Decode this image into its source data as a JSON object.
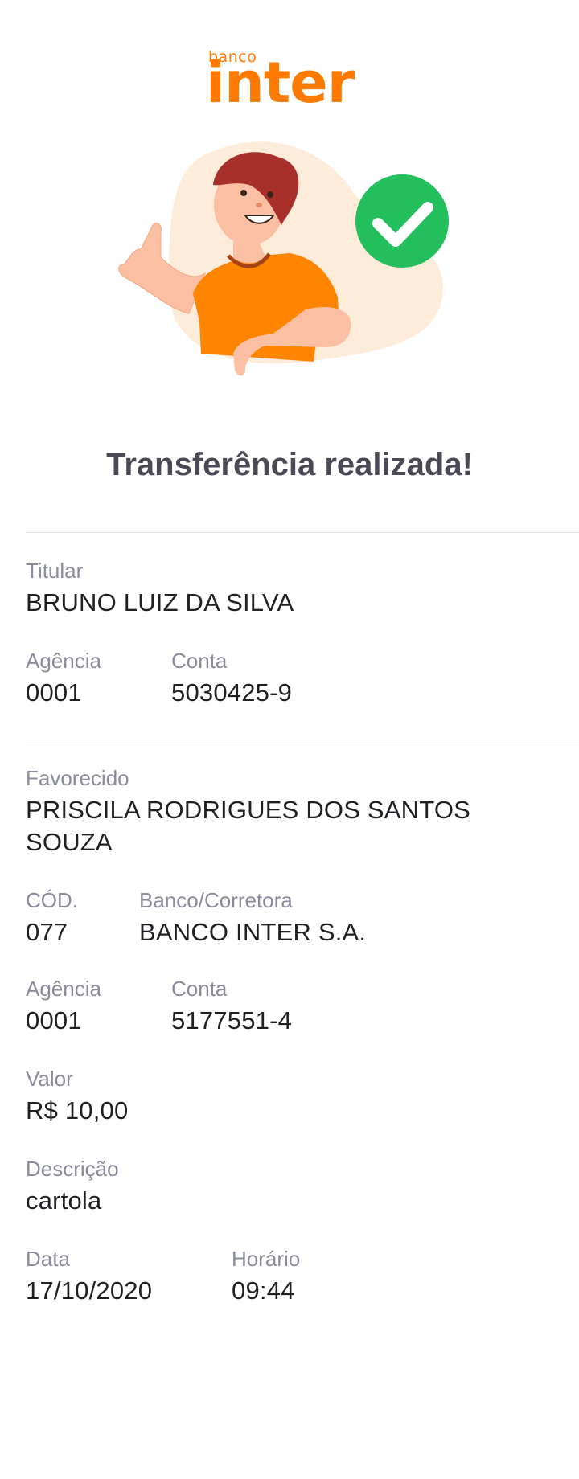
{
  "brand": {
    "small": "banco",
    "name": "inter"
  },
  "title": "Transferência realizada!",
  "holder": {
    "titular_label": "Titular",
    "titular_value": "BRUNO LUIZ DA SILVA",
    "agencia_label": "Agência",
    "agencia_value": "0001",
    "conta_label": "Conta",
    "conta_value": "5030425-9"
  },
  "recipient": {
    "favorecido_label": "Favorecido",
    "favorecido_line1": "PRISCILA RODRIGUES DOS SANTOS",
    "favorecido_line2": "SOUZA",
    "cod_label": "CÓD.",
    "cod_value": "077",
    "banco_label": "Banco/Corretora",
    "banco_value": "BANCO INTER S.A.",
    "agencia_label": "Agência",
    "agencia_value": "0001",
    "conta_label": "Conta",
    "conta_value": "5177551-4"
  },
  "transfer": {
    "valor_label": "Valor",
    "valor_value": "R$ 10,00",
    "descricao_label": "Descrição",
    "descricao_value": "cartola",
    "data_label": "Data",
    "data_value": "17/10/2020",
    "horario_label": "Horário",
    "horario_value": "09:44"
  },
  "colors": {
    "brand_orange": "#ff7a00",
    "success_green": "#22bf5c",
    "label_gray": "#8a8c9e",
    "value_dark": "#1f2024"
  },
  "icons": [
    "checkmark-icon"
  ]
}
